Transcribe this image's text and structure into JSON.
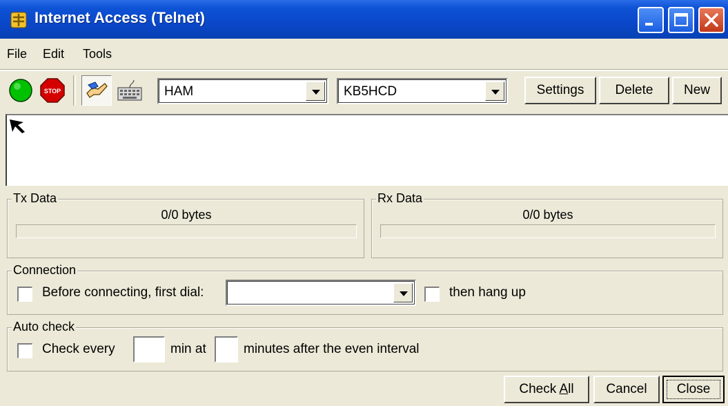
{
  "window": {
    "title": "Internet Access (Telnet)"
  },
  "menu": {
    "file": "File",
    "edit": "Edit",
    "tools": "Tools"
  },
  "toolbar": {
    "profile_value": "HAM",
    "callsign_value": "KB5HCD",
    "settings_label": "Settings",
    "delete_label": "Delete",
    "new_label": "New",
    "stop_label": "STOP"
  },
  "tx": {
    "label": "Tx Data",
    "bytes": "0/0 bytes",
    "progress": 0
  },
  "rx": {
    "label": "Rx Data",
    "bytes": "0/0 bytes",
    "progress": 0
  },
  "connection": {
    "label": "Connection",
    "dial_label": "Before connecting, first dial:",
    "dial_value": "",
    "hangup_label": "then hang up",
    "dial_checked": false,
    "hangup_checked": false
  },
  "autocheck": {
    "label": "Auto check",
    "check_every_label": "Check every",
    "interval_value": "",
    "min_at_label": "min at",
    "offset_value": "",
    "after_label": "minutes after the even interval",
    "checked": false
  },
  "footer": {
    "check_all_prefix": "Check ",
    "check_all_accel": "A",
    "check_all_suffix": "ll",
    "cancel_label": "Cancel",
    "close_label": "Close"
  },
  "colors": {
    "titlebar": "#0a47c9",
    "face": "#ece9d8",
    "go": "#00c000",
    "stop": "#d40000"
  },
  "icons": [
    "app-icon",
    "go-icon",
    "stop-icon",
    "handshake-icon",
    "keyboard-icon",
    "minimize-icon",
    "maximize-icon",
    "close-icon",
    "cursor-icon"
  ]
}
